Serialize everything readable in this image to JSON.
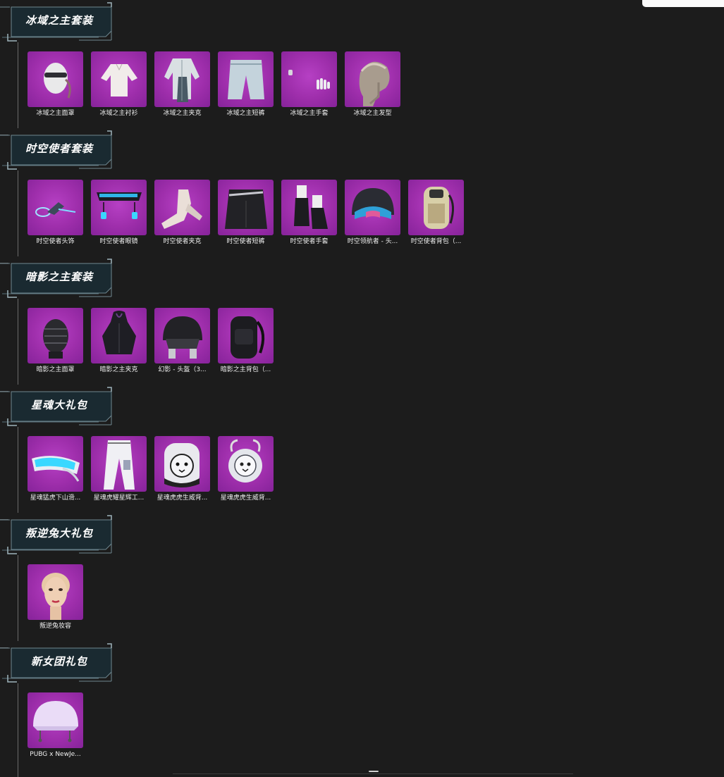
{
  "sections": [
    {
      "title": "冰域之主套装",
      "items": [
        {
          "label": "冰域之主面罩",
          "icon": "mask-icon"
        },
        {
          "label": "冰域之主衬衫",
          "icon": "shirt-icon"
        },
        {
          "label": "冰域之主夹克",
          "icon": "jacket-icon"
        },
        {
          "label": "冰域之主短裤",
          "icon": "shorts-icon"
        },
        {
          "label": "冰域之主手套",
          "icon": "gloves-icon"
        },
        {
          "label": "冰域之主发型",
          "icon": "hairstyle-icon"
        }
      ]
    },
    {
      "title": "时空使者套装",
      "items": [
        {
          "label": "时空使者头饰",
          "icon": "headwear-icon"
        },
        {
          "label": "时空使者眼镜",
          "icon": "glasses-icon"
        },
        {
          "label": "时空使者夹克",
          "icon": "jacket-icon"
        },
        {
          "label": "时空使者短裤",
          "icon": "shorts-icon"
        },
        {
          "label": "时空使者手套",
          "icon": "gloves-icon"
        },
        {
          "label": "时空领航者 - 头...",
          "icon": "helmet-icon"
        },
        {
          "label": "时空使者背包（...",
          "icon": "backpack-icon"
        }
      ]
    },
    {
      "title": "暗影之主套装",
      "items": [
        {
          "label": "暗影之主面罩",
          "icon": "mask-icon"
        },
        {
          "label": "暗影之主夹克",
          "icon": "jacket-icon"
        },
        {
          "label": "幻影 - 头盔（3...",
          "icon": "helmet-icon"
        },
        {
          "label": "暗影之主背包（...",
          "icon": "backpack-icon"
        }
      ]
    },
    {
      "title": "星魂大礼包",
      "items": [
        {
          "label": "星魂猛虎下山滑...",
          "icon": "goggles-icon"
        },
        {
          "label": "星魂虎耀星辉工...",
          "icon": "pants-icon"
        },
        {
          "label": "星魂虎虎生威背...",
          "icon": "tiger-backpack-icon"
        },
        {
          "label": "星魂虎虎生威背...",
          "icon": "tiger-backpack-icon"
        }
      ]
    },
    {
      "title": "叛逆兔大礼包",
      "items": [
        {
          "label": "叛逆兔妆容",
          "icon": "face-makeup-icon"
        }
      ]
    },
    {
      "title": "新女团礼包",
      "items": [
        {
          "label": "PUBG x NewJe...",
          "icon": "helmet-icon"
        }
      ]
    }
  ],
  "colors": {
    "background": "#1c1c1c",
    "tile": "#a033ae",
    "header_fill": "#1d2c33",
    "header_border": "#6f8790"
  }
}
